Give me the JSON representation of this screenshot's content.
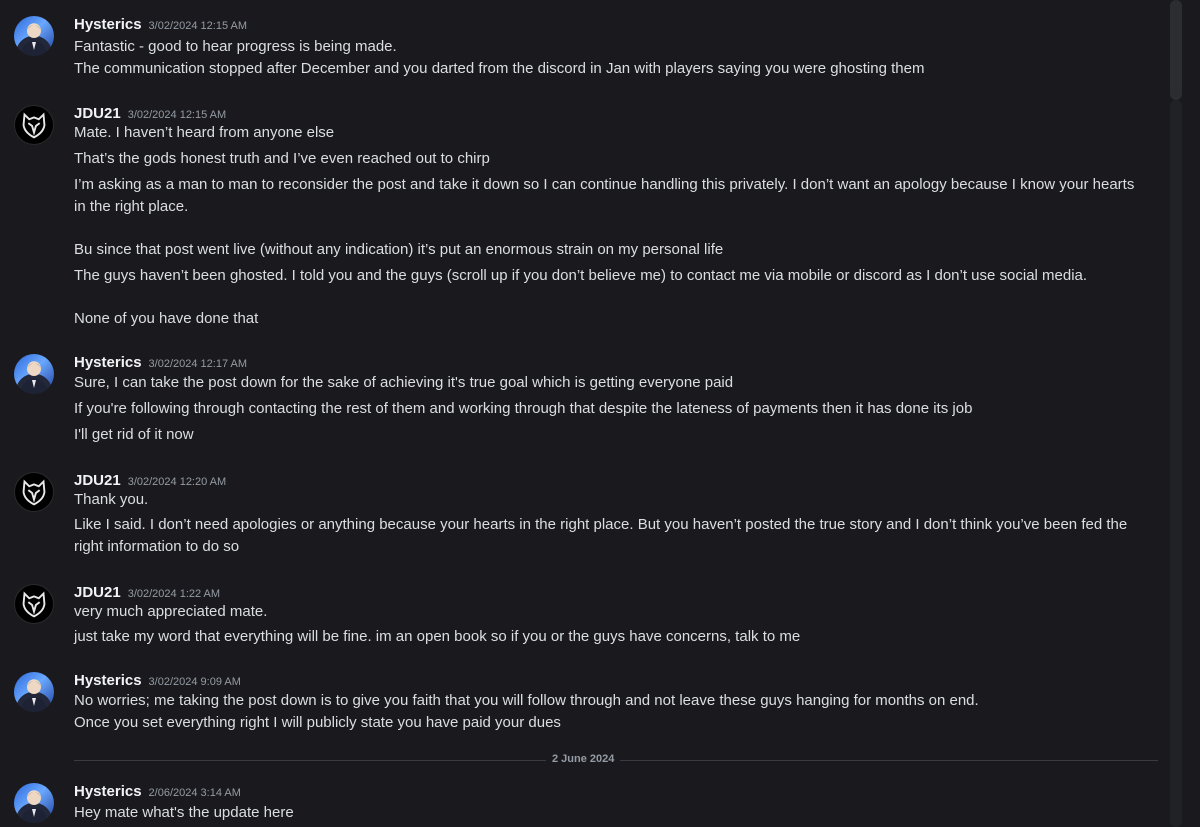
{
  "messages": [
    {
      "author": "Hysterics",
      "timestamp": "3/02/2024 12:15 AM",
      "avatar": "hysterics-avatar",
      "lines": [
        "Fantastic - good to hear progress is being made.",
        "The communication stopped after December and you darted from the discord in Jan with players saying you were ghosting them"
      ]
    },
    {
      "author": "JDU21",
      "timestamp": "3/02/2024 12:15 AM",
      "avatar": "jdu21-avatar",
      "lines": [
        "Mate. I haven’t heard from anyone else",
        "That’s the gods honest truth and I’ve even reached out to chirp",
        "I’m asking as a man to man to reconsider the post and take it down so I can continue handling this privately. I don’t want an apology because I know your hearts in the right place.",
        "Bu since that post went live (without any indication) it’s put an enormous strain on my personal life",
        "The guys haven’t been ghosted. I told you and the guys (scroll up if you don’t believe me) to contact me via mobile or discord as I don’t use social media.",
        "None of you have done that"
      ]
    },
    {
      "author": "Hysterics",
      "timestamp": "3/02/2024 12:17 AM",
      "avatar": "hysterics-avatar",
      "lines": [
        "Sure, I can take the post down for the sake of achieving it's true goal which is getting everyone paid",
        "If you're following through contacting the rest of them and working through that despite the lateness of payments then it has done its job",
        "I'll get rid of it now"
      ]
    },
    {
      "author": "JDU21",
      "timestamp": "3/02/2024 12:20 AM",
      "avatar": "jdu21-avatar",
      "lines": [
        "Thank you.",
        "Like I said. I don’t need apologies or anything because your hearts in the right place. But you haven’t posted the true story and I don’t think you’ve been fed the right information to do so"
      ]
    },
    {
      "author": "JDU21",
      "timestamp": "3/02/2024 1:22 AM",
      "avatar": "jdu21-avatar",
      "lines": [
        "very much appreciated mate.",
        "just take my word that everything will be fine. im an open book so if you or the guys have concerns, talk to me"
      ]
    },
    {
      "author": "Hysterics",
      "timestamp": "3/02/2024 9:09 AM",
      "avatar": "hysterics-avatar",
      "lines": [
        "No worries; me taking the post down is to give you faith that you will follow through and not leave these guys hanging for months on end.",
        "Once you set everything right I will publicly state you have paid your dues"
      ]
    },
    {
      "author": "Hysterics",
      "timestamp": "2/06/2024 3:14 AM",
      "avatar": "hysterics-avatar",
      "lines": [
        "Hey mate what's the update here"
      ]
    }
  ],
  "date_divider": "2 June 2024",
  "colors": {
    "background": "#1a1a1e",
    "username": "#f2f3f5",
    "timestamp": "#949ba4",
    "text": "#dbdee1"
  }
}
